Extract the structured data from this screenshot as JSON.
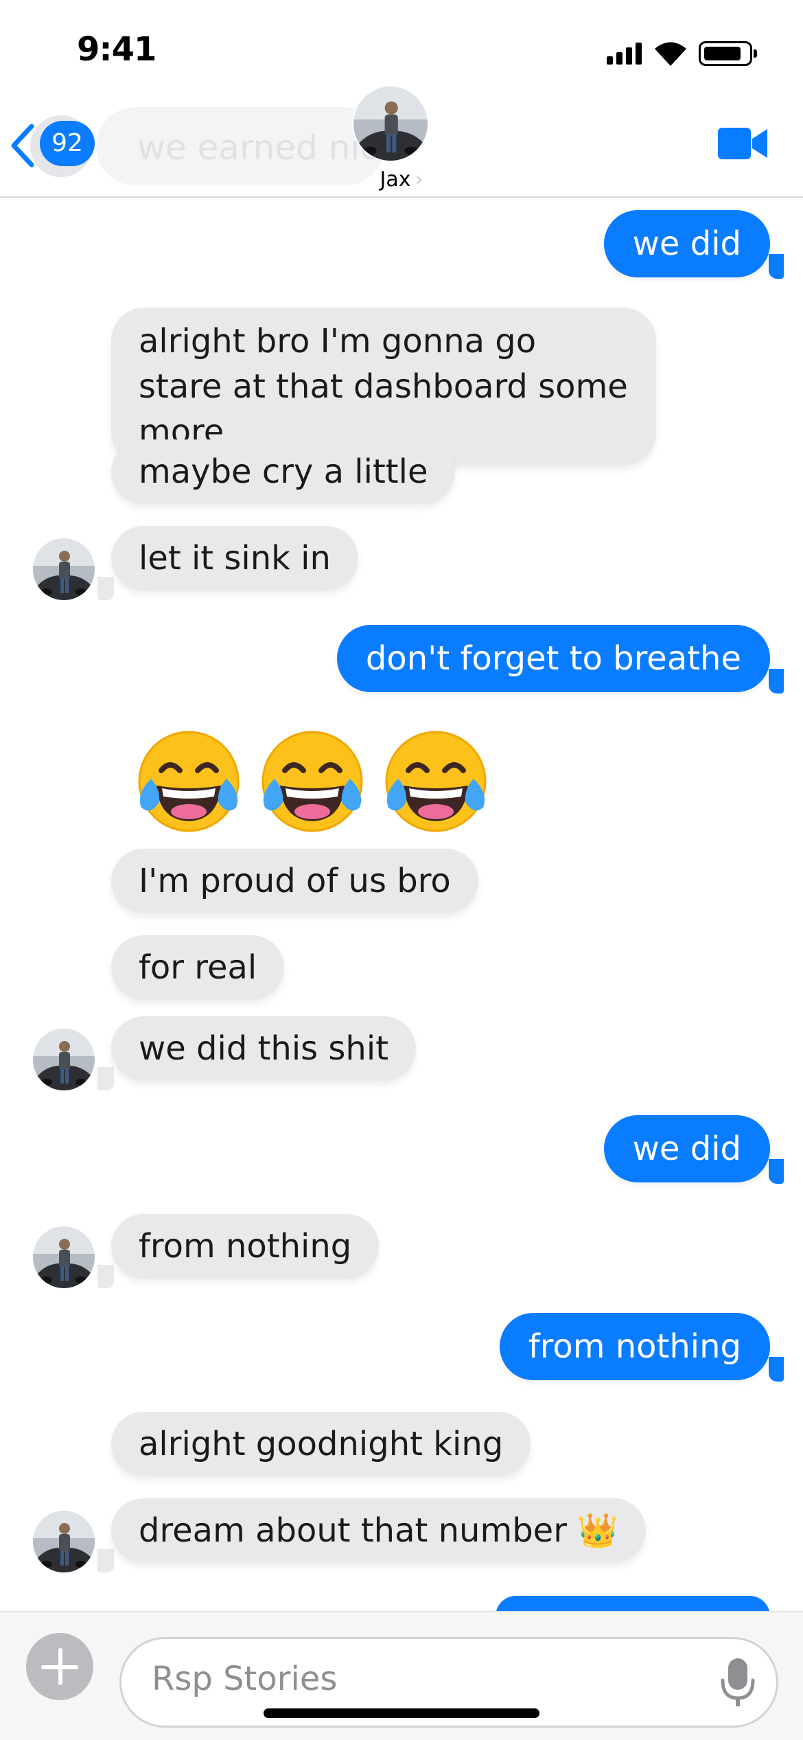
{
  "status_bar": {
    "time": "9:41"
  },
  "header": {
    "back_count": "92",
    "preview_text": "we earned nice",
    "contact_name": "Jax",
    "name_chevron": "›",
    "icons": [
      "chevron-left-icon",
      "video-camera-icon"
    ],
    "accent_color": "#0a7cff"
  },
  "messages": [
    {
      "side": "out",
      "text": "we did"
    },
    {
      "side": "in",
      "text": "alright bro I'm gonna go stare at that dashboard some more"
    },
    {
      "side": "in",
      "text": "maybe cry a little"
    },
    {
      "side": "in",
      "text": "let it sink in"
    },
    {
      "side": "out",
      "text": "don't forget to breathe"
    },
    {
      "side": "in",
      "emoji": "face-with-tears-of-joy x3"
    },
    {
      "side": "in",
      "text": "I'm proud of us bro"
    },
    {
      "side": "in",
      "text": "for real"
    },
    {
      "side": "in",
      "text": "we did this shit"
    },
    {
      "side": "out",
      "text": "we did"
    },
    {
      "side": "in",
      "text": "from nothing"
    },
    {
      "side": "out",
      "text": "from nothing"
    },
    {
      "side": "in",
      "text": "alright goodnight king"
    },
    {
      "side": "in",
      "text": "dream about that number 👑"
    }
  ],
  "composer": {
    "placeholder": "Rsp Stories",
    "icons": [
      "plus-icon",
      "microphone-icon"
    ]
  }
}
